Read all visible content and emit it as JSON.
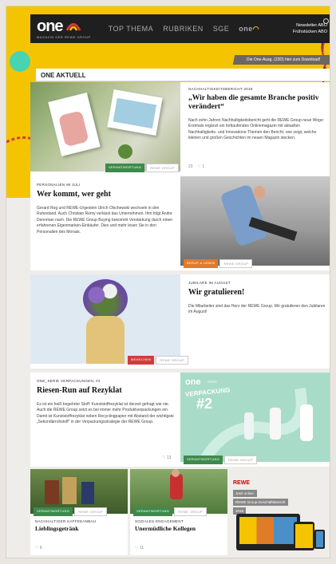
{
  "header": {
    "logo": "one",
    "logo_sub": "MAGAZIN DER REWE GROUP",
    "nav": [
      "TOP THEMA",
      "RUBRIKEN",
      "SGE"
    ],
    "nav_one": "one",
    "newsletter": "Newsletter ABO",
    "fruhstuck": "Frühstücken ABO"
  },
  "download_banner": "Die One-Ausg. (23D) hier zum Download!",
  "section_title": "ONE AKTUELL",
  "cards": {
    "c1": {
      "kicker": "NACHHALTIGKEITSBERICHT 2018",
      "headline": "„Wir haben die gesamte Branche positiv verändert“",
      "body": "Nach zehn Jahren Nachhaltigkeitsbericht geht die REWE Group neue Wege: Erstmals ergänzt ein fortlaufendes Onlinemagazin mit aktuellen Nachhaltigkeits- und Innovations-Themen den Bericht. one zeigt, welche kleinen und großen Geschichten im neuen Magazin stecken.",
      "tags": [
        "VERANTWORTUNG",
        "REWE GROUP"
      ],
      "meta": [
        "23",
        "♡ 1"
      ]
    },
    "c2": {
      "kicker": "PERSONALIEN IM JULI",
      "headline": "Wer kommt, wer geht",
      "body": "Gerard Rog und REWE-Urgestein Ulrich Olschewski wechseln in den Ruhestand. Auch Christian Remy verlässt das Unternehmen. Ihm folgt Andre Dennman nach. Die REWE Group Buying bekommt Verstärkung durch einen erfahrenen Eigenmarken-Einkäufer. Dies und mehr lesen Sie in den Personalien des Monats.",
      "tags": [
        "BERUF & LEBEN",
        "REWE GROUP"
      ]
    },
    "c3": {
      "kicker": "JUBILARE IM AUGUST",
      "headline": "Wir gratulieren!",
      "body": "Die Mitarbeiter sind das Herz der REWE Group. Wir gratulieren den Jubilaren im August!",
      "tags": [
        "MENSCHEN",
        "REWE GROUP"
      ]
    },
    "c4": {
      "kicker": "ONE_SERIE VERPACKUNGEN, #2",
      "headline": "Riesen-Run auf Rezyklat",
      "body": "Es ist ein heiß begehrter Stoff: Kunststoffrezyklat ist derzeit gefragt wie nie. Auch die REWE Group setzt es bei immer mehr Produktverpackungen ein. Damit ist Kunststoffrezyklat neben Recyclingpapier mit Abstand der wichtigste „Sekundärrohstoff“ in der Verpackungsstrategie der REWE Group.",
      "tags": [
        "VERANTWORTUNG",
        "REWE GROUP"
      ],
      "meta": [
        "♡ 13"
      ],
      "badge_one": "one",
      "badge_serie": "SERIE",
      "badge_main": "VERPACKUNG",
      "badge_num": "#2"
    },
    "c5": {
      "kicker": "NACHHALTIGER KAFFEEANBAU",
      "headline": "Lieblingsgetränk",
      "tags": [
        "VERANTWORTUNG",
        "REWE GROUP"
      ],
      "meta": [
        "♡ 8"
      ]
    },
    "c6": {
      "kicker": "SOZIALES ENGAGEMENT",
      "headline": "Unermüdliche Kollegen",
      "tags": [
        "VERANTWORTUNG",
        "REWE GROUP"
      ],
      "meta": [
        "♡ 11"
      ]
    },
    "c7": {
      "brand": "REWE",
      "lines": [
        "Jetzt online:",
        "REWE Group-Geschäftsbericht",
        "2018"
      ]
    }
  },
  "colors": {
    "yellow": "#f5c400",
    "dark": "#1f1f1f",
    "green_tag": "#3e8a4c",
    "teal": "#48d4b0"
  }
}
